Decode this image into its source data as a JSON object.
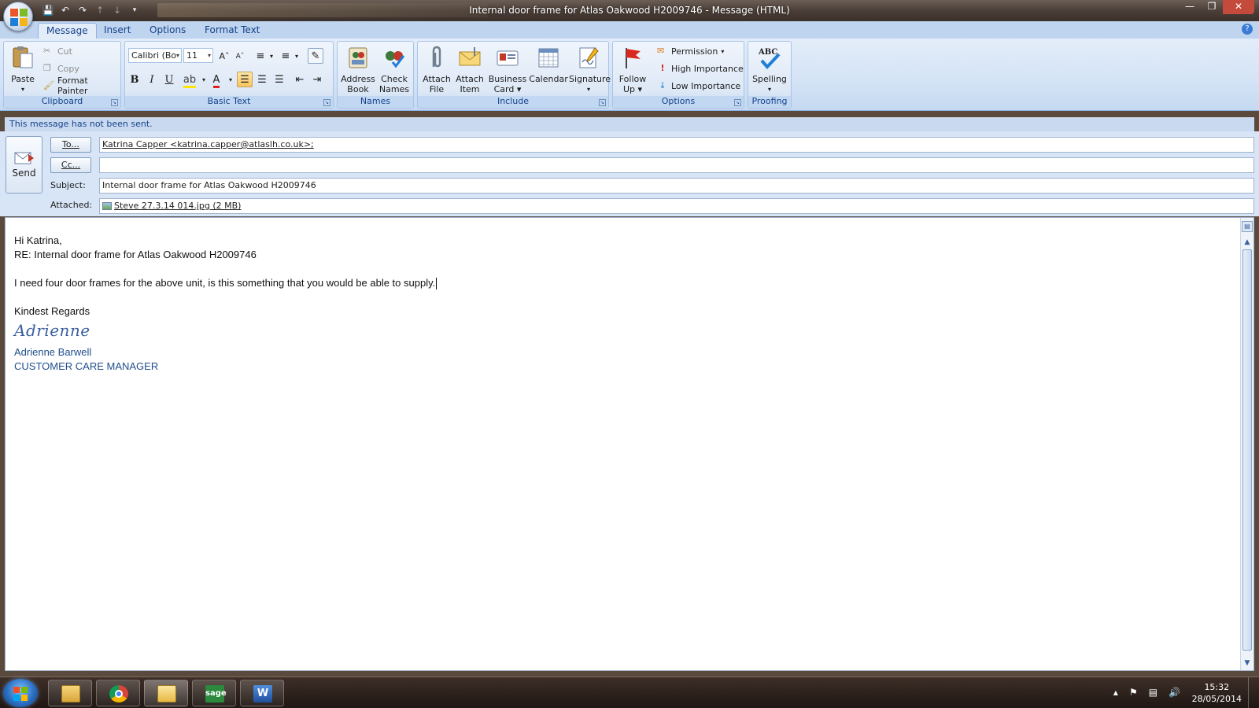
{
  "window": {
    "title": "Internal door frame for Atlas Oakwood H2009746 - Message (HTML)",
    "controls": [
      "minimize-icon",
      "restore-icon",
      "close-icon"
    ]
  },
  "ribbon": {
    "tabs": [
      {
        "label": "Message",
        "active": true
      },
      {
        "label": "Insert",
        "active": false
      },
      {
        "label": "Options",
        "active": false
      },
      {
        "label": "Format Text",
        "active": false
      }
    ],
    "clipboard": {
      "label": "Clipboard",
      "paste": "Paste",
      "cut": "Cut",
      "copy": "Copy",
      "format_painter": "Format Painter"
    },
    "basic_text": {
      "label": "Basic Text",
      "font": "Calibri (Bo",
      "size": "11",
      "bold": "B",
      "italic": "I",
      "underline": "U"
    },
    "names": {
      "label": "Names",
      "address_book": [
        "Address",
        "Book"
      ],
      "check_names": [
        "Check",
        "Names"
      ]
    },
    "include": {
      "label": "Include",
      "attach_file": [
        "Attach",
        "File"
      ],
      "attach_item": [
        "Attach",
        "Item"
      ],
      "business_card": [
        "Business",
        "Card ▾"
      ],
      "calendar": "Calendar",
      "signature": "Signature"
    },
    "options": {
      "label": "Options",
      "follow_up": [
        "Follow",
        "Up ▾"
      ],
      "permission": "Permission",
      "high_importance": "High Importance",
      "low_importance": "Low Importance"
    },
    "proofing": {
      "label": "Proofing",
      "spelling": "Spelling",
      "abc": "ABC"
    }
  },
  "infobar": "This message has not been sent.",
  "header": {
    "send": "Send",
    "to_button": "To...",
    "cc_button": "Cc...",
    "to_value": "Katrina Capper <katrina.capper@atlaslh.co.uk>;",
    "cc_value": "",
    "subject_label": "Subject:",
    "subject_value": "Internal door frame for Atlas Oakwood H2009746",
    "attached_label": "Attached:",
    "attachment": "Steve 27.3.14 014.jpg (2 MB)"
  },
  "body": {
    "greeting": "Hi Katrina,",
    "re_line": "RE: Internal door frame for Atlas Oakwood H2009746",
    "message": "I need four door frames for the above unit, is this something that you would be able to supply.",
    "closing": "Kindest Regards",
    "signature_script": "Adrienne",
    "signature_name": "Adrienne Barwell",
    "signature_title": "CUSTOMER CARE MANAGER"
  },
  "taskbar": {
    "apps": [
      "file-explorer",
      "chrome",
      "outlook",
      "sage",
      "word"
    ],
    "sage_label": "sage",
    "clock_time": "15:32",
    "clock_date": "28/05/2014"
  }
}
